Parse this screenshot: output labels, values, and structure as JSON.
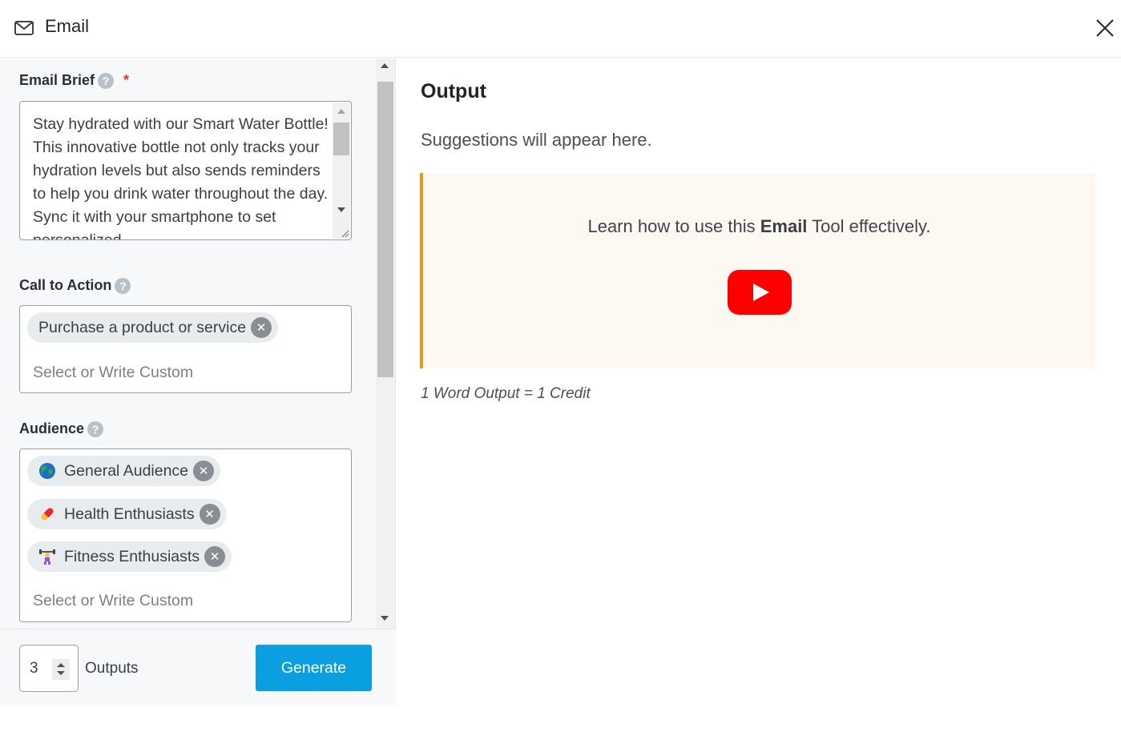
{
  "header": {
    "icon": "mail-icon",
    "title": "Email",
    "close_icon": "close-icon"
  },
  "form": {
    "email_brief": {
      "label": "Email Brief",
      "required_mark": "*",
      "help_glyph": "?",
      "value": "Stay hydrated with our Smart Water Bottle! This innovative bottle not only tracks your hydration levels but also sends reminders to help you drink water throughout the day. Sync it with your smartphone to set personalized"
    },
    "call_to_action": {
      "label": "Call to Action",
      "help_glyph": "?",
      "tags": [
        {
          "label": "Purchase a product or service",
          "remove_glyph": "✕"
        }
      ],
      "placeholder": "Select or Write Custom"
    },
    "audience": {
      "label": "Audience",
      "help_glyph": "?",
      "tags": [
        {
          "emoji": "globe-icon",
          "label": "General Audience",
          "remove_glyph": "✕"
        },
        {
          "emoji": "pill-icon",
          "label": "Health Enthusiasts",
          "remove_glyph": "✕"
        },
        {
          "emoji": "weightlifter-icon",
          "label": "Fitness Enthusiasts",
          "remove_glyph": "✕"
        }
      ],
      "placeholder": "Select or Write Custom"
    }
  },
  "footer": {
    "outputs_value": "3",
    "outputs_label": "Outputs",
    "generate_label": "Generate"
  },
  "output": {
    "title": "Output",
    "subtitle": "Suggestions will appear here.",
    "learn_prefix": "Learn how to use this ",
    "learn_bold": "Email",
    "learn_suffix": " Tool effectively.",
    "video_icon": "youtube-play-icon",
    "credit_note": "1 Word Output = 1 Credit"
  },
  "colors": {
    "accent": "#0a9fe0",
    "required": "#e5322d",
    "callout_border": "#e59b13",
    "callout_bg": "#fdf8f2",
    "youtube_red": "#ff0000"
  }
}
